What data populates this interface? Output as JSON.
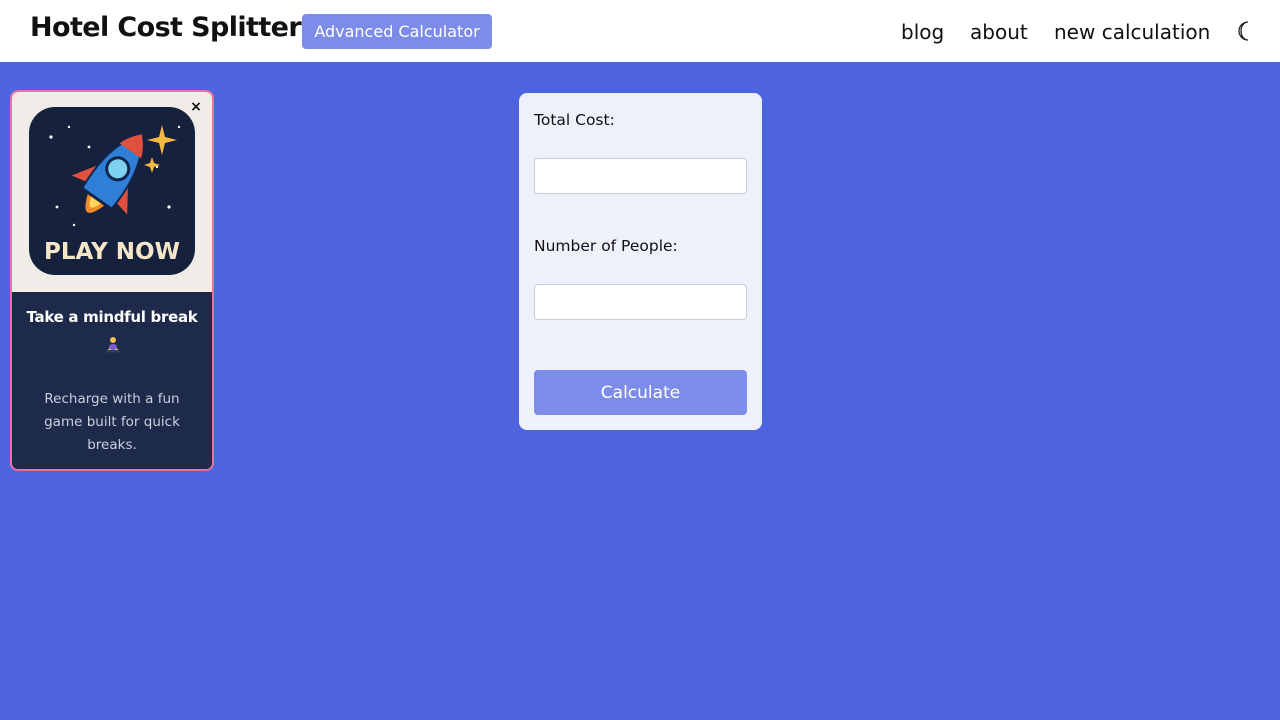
{
  "header": {
    "title": "Hotel Cost Splitter",
    "advanced_button": "Advanced Calculator",
    "nav": {
      "blog": "blog",
      "about": "about",
      "new_calculation": "new calculation",
      "theme_toggle_icon": "moon-icon"
    }
  },
  "ad": {
    "close_label": "×",
    "image_text": "PLAY NOW",
    "image_icon": "rocket-icon",
    "headline": "Take a mindful break",
    "emoji_icon": "meditation-emoji-icon",
    "body": "Recharge with a fun game built for quick breaks.",
    "border_color": "#e8739d"
  },
  "calculator": {
    "total_cost_label": "Total Cost:",
    "total_cost_value": "",
    "people_label": "Number of People:",
    "people_value": "",
    "calculate_label": "Calculate"
  },
  "colors": {
    "page_background": "#4e63e0",
    "accent": "#7c8ce8",
    "card_background": "#eef0fb"
  }
}
